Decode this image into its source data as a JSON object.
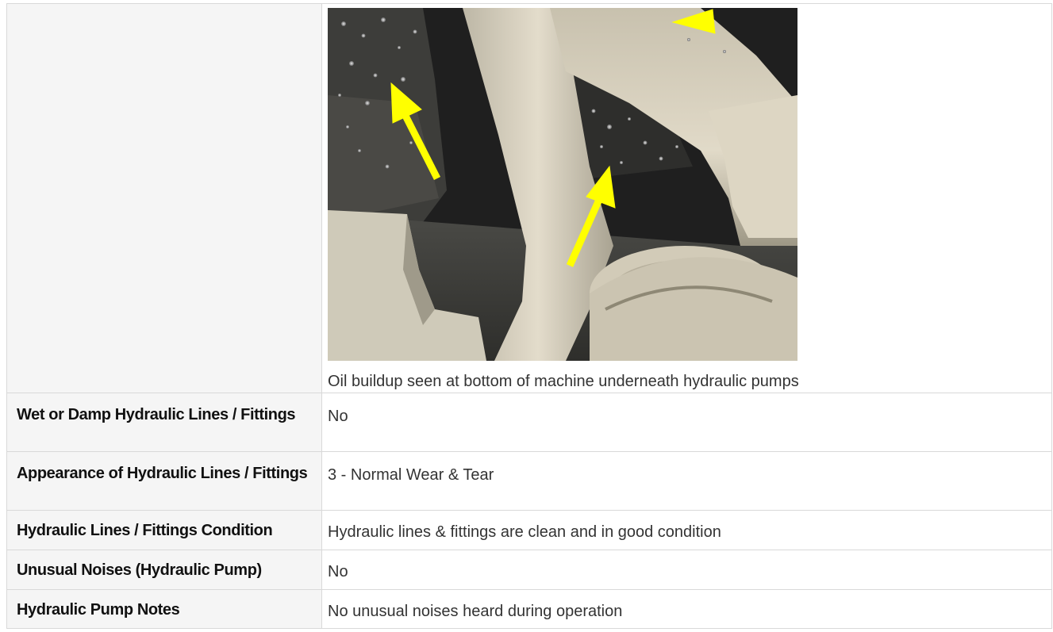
{
  "photo": {
    "caption": "Oil buildup seen at bottom of machine underneath hydraulic pumps",
    "arrow_color": "#ffff00"
  },
  "rows": [
    {
      "label": "Wet or Damp Hydraulic Lines / Fittings",
      "value": "No"
    },
    {
      "label": "Appearance of Hydraulic Lines / Fittings",
      "value": "3 - Normal Wear & Tear"
    },
    {
      "label": "Hydraulic Lines / Fittings Condition",
      "value": "Hydraulic lines & fittings are clean and in good condition"
    },
    {
      "label": "Unusual Noises (Hydraulic Pump)",
      "value": "No"
    },
    {
      "label": "Hydraulic Pump Notes",
      "value": "No unusual noises heard during operation"
    }
  ]
}
